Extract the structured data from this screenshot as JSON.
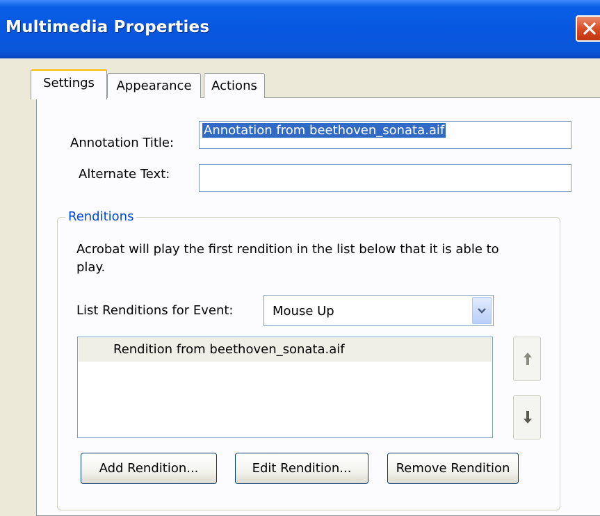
{
  "window": {
    "title": "Multimedia Properties"
  },
  "tabs": [
    {
      "label": "Settings"
    },
    {
      "label": "Appearance"
    },
    {
      "label": "Actions"
    }
  ],
  "form": {
    "annotation_title_label": "Annotation Title:",
    "annotation_title_value": "Annotation from beethoven_sonata.aif",
    "alternate_text_label": "Alternate Text:",
    "alternate_text_value": ""
  },
  "renditions": {
    "group_label": "Renditions",
    "description": "Acrobat will play the first rendition in the list below that it is able to play.",
    "event_label": "List Renditions for Event:",
    "event_value": "Mouse Up",
    "items": [
      {
        "label": "Rendition from beethoven_sonata.aif"
      }
    ],
    "buttons": {
      "add": "Add Rendition...",
      "edit": "Edit Rendition...",
      "remove": "Remove Rendition"
    }
  },
  "icons": {
    "close": "close-icon",
    "dropdown": "chevron-down-icon",
    "move_up": "arrow-up-icon",
    "move_down": "arrow-down-icon"
  }
}
